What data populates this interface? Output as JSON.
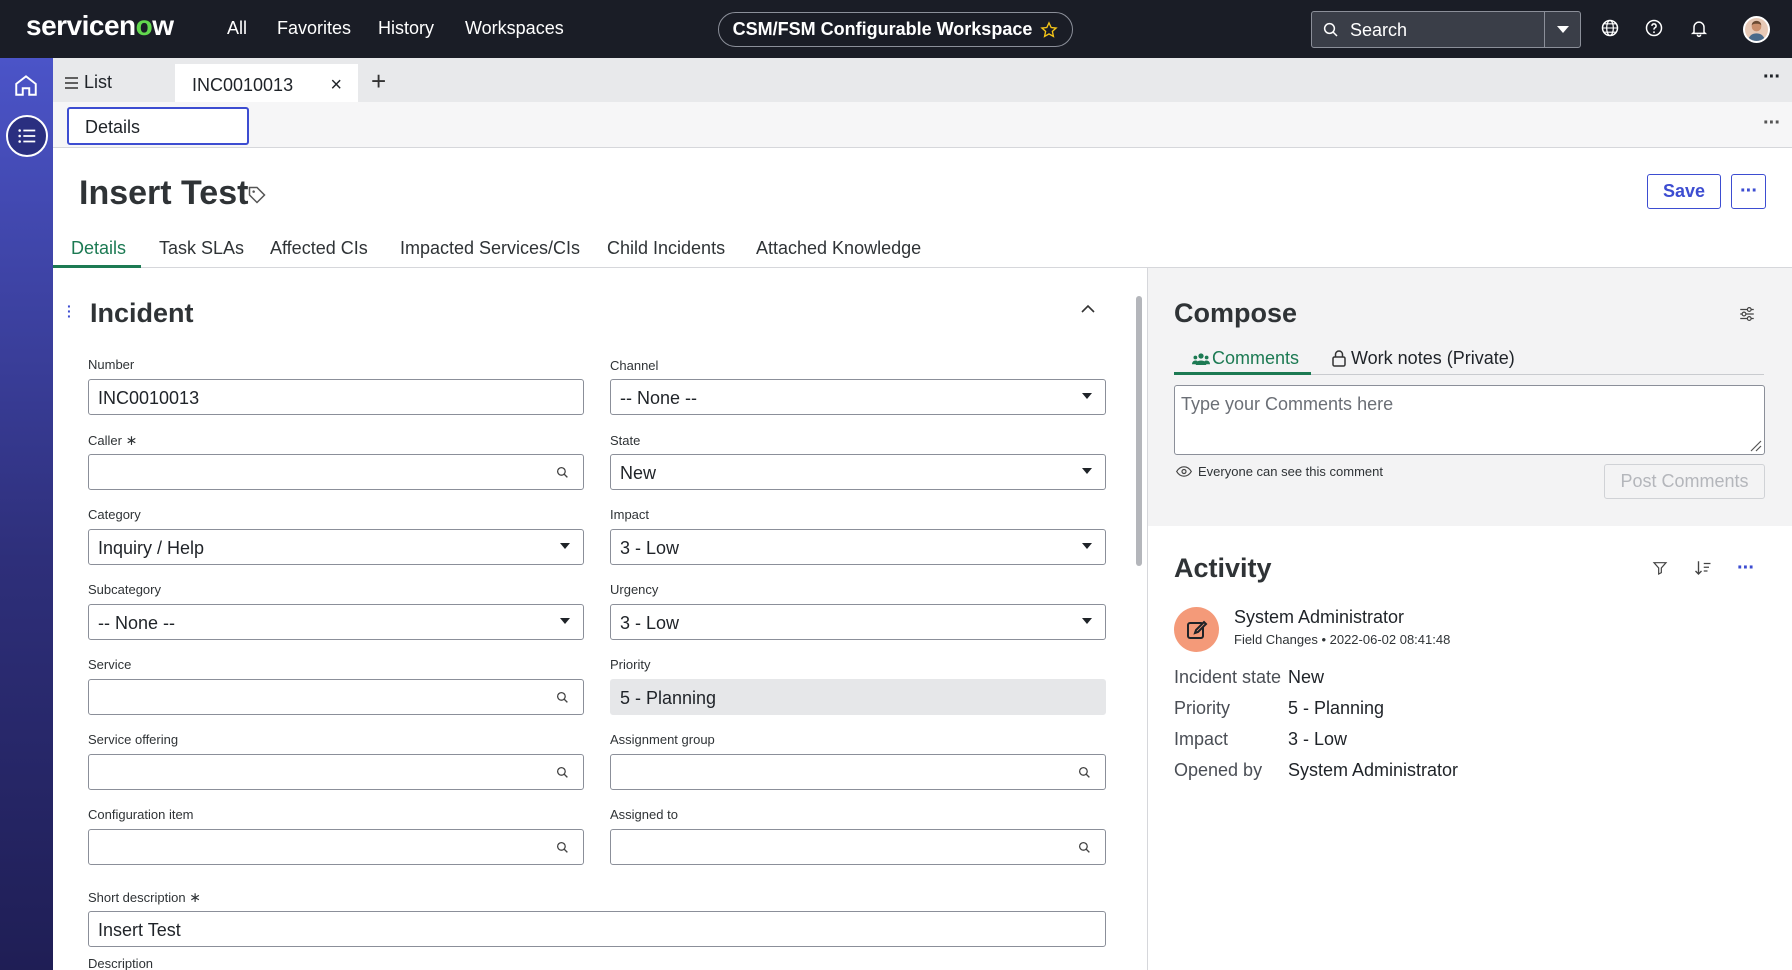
{
  "topnav": {
    "logo_text": "servicenow",
    "links": [
      "All",
      "Favorites",
      "History",
      "Workspaces"
    ],
    "workspace": "CSM/FSM Configurable Workspace",
    "search_label": "Search"
  },
  "tabs": {
    "list_label": "List",
    "active_label": "INC0010013"
  },
  "subtab": "Details",
  "record": {
    "title": "Insert Test",
    "save_label": "Save"
  },
  "record_tabs": [
    "Details",
    "Task SLAs",
    "Affected CIs",
    "Impacted Services/CIs",
    "Child Incidents",
    "Attached Knowledge"
  ],
  "section": {
    "title": "Incident"
  },
  "fields": {
    "number": {
      "label": "Number",
      "value": "INC0010013"
    },
    "channel": {
      "label": "Channel",
      "value": "-- None --"
    },
    "caller": {
      "label": "Caller",
      "value": ""
    },
    "state": {
      "label": "State",
      "value": "New"
    },
    "category": {
      "label": "Category",
      "value": "Inquiry / Help"
    },
    "impact": {
      "label": "Impact",
      "value": "3 - Low"
    },
    "subcategory": {
      "label": "Subcategory",
      "value": "-- None --"
    },
    "urgency": {
      "label": "Urgency",
      "value": "3 - Low"
    },
    "service": {
      "label": "Service",
      "value": ""
    },
    "priority": {
      "label": "Priority",
      "value": "5 - Planning"
    },
    "service_offering": {
      "label": "Service offering",
      "value": ""
    },
    "assignment_group": {
      "label": "Assignment group",
      "value": ""
    },
    "configuration_item": {
      "label": "Configuration item",
      "value": ""
    },
    "assigned_to": {
      "label": "Assigned to",
      "value": ""
    },
    "short_description": {
      "label": "Short description",
      "value": "Insert Test"
    },
    "description": {
      "label": "Description"
    }
  },
  "compose": {
    "title": "Compose",
    "tab_comments": "Comments",
    "tab_worknotes": "Work notes (Private)",
    "placeholder": "Type your Comments here",
    "visibility_note": "Everyone can see this comment",
    "post_label": "Post Comments"
  },
  "activity": {
    "title": "Activity",
    "entry": {
      "user": "System Administrator",
      "type": "Field Changes",
      "timestamp": "2022-06-02 08:41:48",
      "changes": [
        {
          "key": "Incident state",
          "value": "New"
        },
        {
          "key": "Priority",
          "value": "5 - Planning"
        },
        {
          "key": "Impact",
          "value": "3 - Low"
        },
        {
          "key": "Opened by",
          "value": "System Administrator"
        }
      ]
    }
  },
  "colors": {
    "nav_bg": "#1a1d26",
    "accent_blue": "#3d4dd1",
    "accent_green": "#1c7a53",
    "logo_green": "#62d84e",
    "activity_avatar": "#f49a79"
  }
}
